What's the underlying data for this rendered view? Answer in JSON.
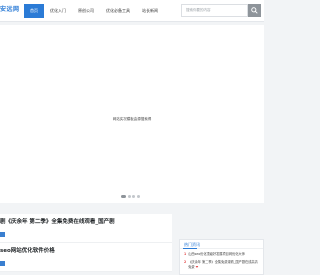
{
  "header": {
    "logo": "安远网",
    "nav": [
      {
        "label": "首页",
        "active": true
      },
      {
        "label": "优化入门",
        "active": false
      },
      {
        "label": "原创公司",
        "active": false
      },
      {
        "label": "优化必备工具",
        "active": false
      },
      {
        "label": "站长新闻",
        "active": false
      }
    ],
    "search_placeholder": "搜索你要的内容"
  },
  "banner": {
    "text": "网站实况模板由源搜索得"
  },
  "posts": [
    {
      "title": "剧《庆余年 第二季》全集免费在线观看_国产剧",
      "tag": "",
      "date": "",
      "views": ""
    },
    {
      "title": "seo网站优化软件价格",
      "tag": "",
      "date": "",
      "views": ""
    }
  ],
  "sidebar": {
    "title": "热门资讯",
    "items": [
      {
        "num": "1",
        "text": "山西seo优化顶级好发展项目网优化大师"
      },
      {
        "num": "2",
        "text": "《庆余年 第二季》全集免费观看_国产剧在线高清免费"
      }
    ],
    "heart": "❤"
  },
  "colors": {
    "accent": "#2b7bd6",
    "rank": "#e34a4a"
  }
}
